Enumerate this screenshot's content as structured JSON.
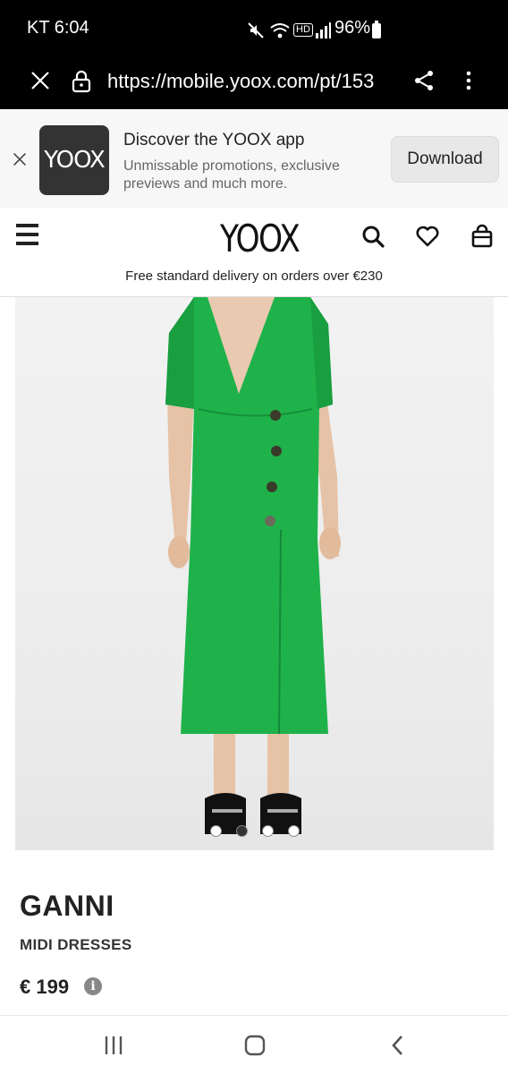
{
  "status_bar": {
    "time": "KT 6:04",
    "battery": "96%",
    "hd_badge": "HD",
    "icons": [
      "mute-icon",
      "wifi-icon",
      "hd-icon",
      "signal-icon",
      "battery-icon"
    ]
  },
  "browser": {
    "url": "https://mobile.yoox.com/pt/153",
    "icons": [
      "close-icon",
      "lock-icon",
      "share-icon",
      "more-vertical-icon"
    ]
  },
  "app_banner": {
    "logo_text": "YOOX",
    "title": "Discover the YOOX app",
    "subtitle": "Unmissable promotions, exclusive previews and much more.",
    "download_label": "Download"
  },
  "header": {
    "logo": "YOOX",
    "delivery_text": "Free standard delivery on orders over €230",
    "icons": [
      "menu-icon",
      "search-icon",
      "heart-icon",
      "bag-icon"
    ]
  },
  "product": {
    "brand": "GANNI",
    "category": "MIDI DRESSES",
    "price": "€ 199",
    "info_icon_glyph": "i",
    "dress_color": "#1fb24a",
    "carousel": {
      "count": 4,
      "active_index": 1
    }
  },
  "colors": {
    "status_bg": "#000000",
    "banner_bg": "#f7f7f7",
    "logo_bg": "#333333"
  }
}
